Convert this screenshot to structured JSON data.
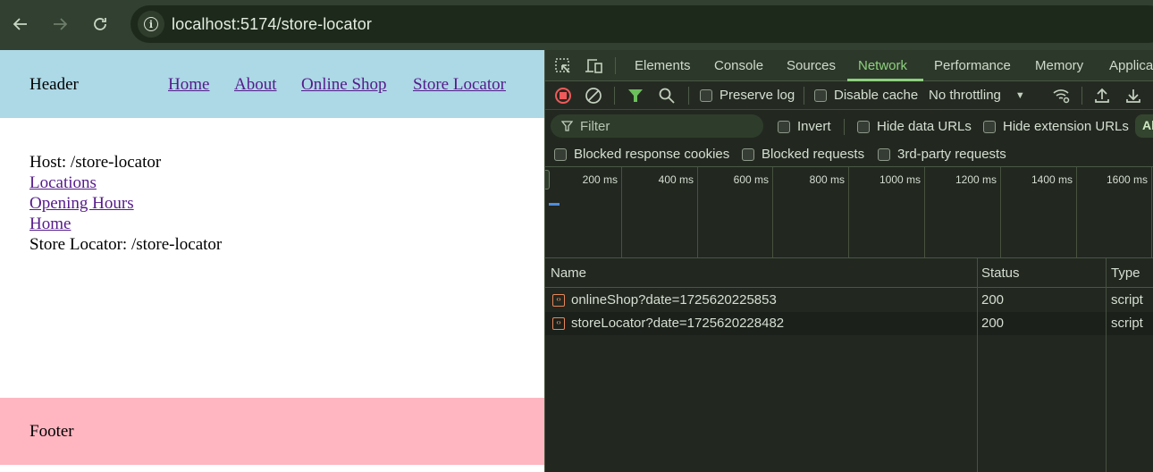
{
  "browser": {
    "url": "localhost:5174/store-locator",
    "icons": {
      "back": "arrow-left-icon",
      "forward": "arrow-right-icon",
      "reload": "reload-icon",
      "site_info": "info-icon"
    }
  },
  "page": {
    "header": {
      "title": "Header",
      "nav": [
        "Home",
        "About",
        "Online Shop",
        "Store Locator"
      ]
    },
    "content": {
      "host_line": "Host: /store-locator",
      "links": [
        "Locations",
        "Opening Hours",
        "Home"
      ],
      "store_line": "Store Locator: /store-locator"
    },
    "footer": {
      "title": "Footer"
    },
    "colors": {
      "header_bg": "#add8e6",
      "footer_bg": "#ffb6c1",
      "link": "#551a8b"
    }
  },
  "devtools": {
    "tabs": [
      "Elements",
      "Console",
      "Sources",
      "Network",
      "Performance",
      "Memory",
      "Applica"
    ],
    "active_tab": "Network",
    "toolbar": {
      "preserve_log": "Preserve log",
      "disable_cache": "Disable cache",
      "throttling": "No throttling"
    },
    "filter": {
      "placeholder": "Filter",
      "invert": "Invert",
      "hide_data_urls": "Hide data URLs",
      "hide_extension_urls": "Hide extension URLs",
      "all_chip": "Al",
      "blocked_response_cookies": "Blocked response cookies",
      "blocked_requests": "Blocked requests",
      "third_party": "3rd-party requests"
    },
    "timeline": {
      "ticks": [
        "200 ms",
        "400 ms",
        "600 ms",
        "800 ms",
        "1000 ms",
        "1200 ms",
        "1400 ms",
        "1600 ms"
      ]
    },
    "table": {
      "columns": [
        "Name",
        "Status",
        "Type"
      ],
      "rows": [
        {
          "name": "onlineShop?date=1725620225853",
          "status": "200",
          "type": "script"
        },
        {
          "name": "storeLocator?date=1725620228482",
          "status": "200",
          "type": "script"
        }
      ]
    },
    "colors": {
      "accent": "#8ed07f",
      "record": "#f05a5a",
      "script_icon": "#e8875a"
    }
  }
}
